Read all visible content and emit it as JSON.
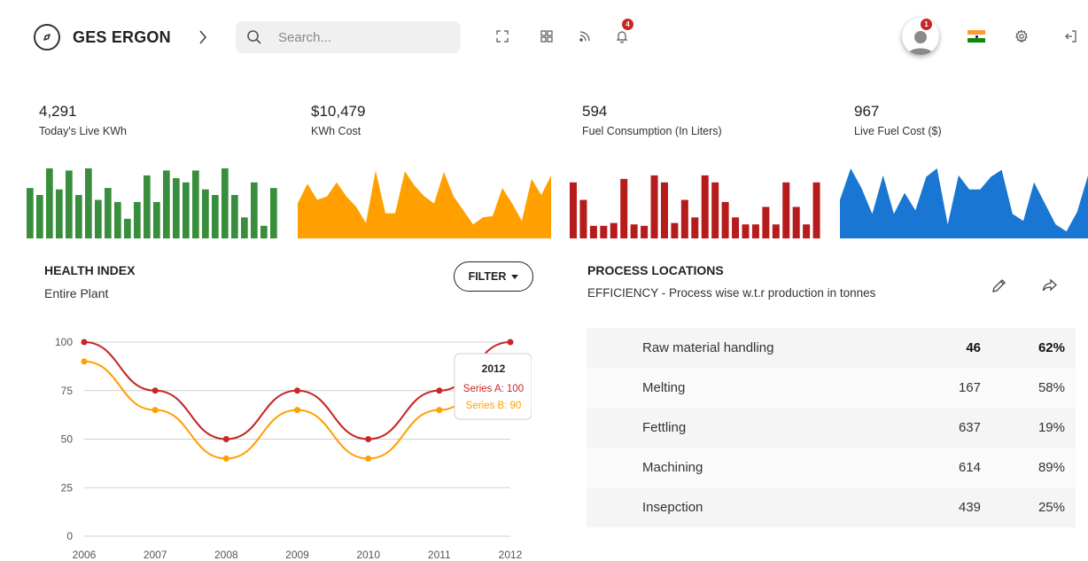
{
  "header": {
    "brand": "GES ERGON",
    "search_placeholder": "Search...",
    "notification_count": "4",
    "avatar_badge": "1",
    "icons": [
      "compass-icon",
      "chevron-right-icon",
      "search-icon",
      "fullscreen-icon",
      "apps-grid-icon",
      "rss-icon",
      "bell-icon",
      "avatar-icon",
      "india-flag-icon",
      "gear-icon",
      "logout-icon"
    ]
  },
  "kpis": [
    {
      "value": "4,291",
      "label": "Today's Live KWh",
      "color": "#388e3c"
    },
    {
      "value": "$10,479",
      "label": "KWh Cost",
      "color": "#ffa000"
    },
    {
      "value": "594",
      "label": "Fuel Consumption (In Liters)",
      "color": "#b71c1c"
    },
    {
      "value": "967",
      "label": "Live Fuel Cost ($)",
      "color": "#1976d2"
    }
  ],
  "sparklines": {
    "kwh_bars": [
      0.72,
      0.62,
      1.0,
      0.7,
      0.97,
      0.62,
      1.0,
      0.55,
      0.72,
      0.52,
      0.28,
      0.52,
      0.9,
      0.52,
      0.97,
      0.86,
      0.8,
      0.97,
      0.7,
      0.62,
      1.0,
      0.62,
      0.3,
      0.8,
      0.18,
      0.72
    ],
    "kwh_cost_area": [
      0.5,
      0.78,
      0.55,
      0.6,
      0.8,
      0.6,
      0.45,
      0.22,
      0.97,
      0.36,
      0.36,
      0.96,
      0.75,
      0.6,
      0.5,
      0.95,
      0.6,
      0.4,
      0.2,
      0.3,
      0.32,
      0.72,
      0.5,
      0.25,
      0.85,
      0.62,
      0.9
    ],
    "fuel_bars": [
      0.8,
      0.55,
      0.18,
      0.18,
      0.22,
      0.85,
      0.2,
      0.18,
      0.9,
      0.8,
      0.22,
      0.55,
      0.3,
      0.9,
      0.8,
      0.52,
      0.3,
      0.2,
      0.2,
      0.45,
      0.2,
      0.8,
      0.45,
      0.2,
      0.8
    ],
    "fuel_cost_area": [
      0.55,
      1.0,
      0.72,
      0.35,
      0.9,
      0.35,
      0.65,
      0.4,
      0.88,
      1.0,
      0.2,
      0.9,
      0.7,
      0.7,
      0.88,
      0.98,
      0.35,
      0.25,
      0.8,
      0.5,
      0.2,
      0.1,
      0.38,
      0.9
    ]
  },
  "health": {
    "title": "HEALTH INDEX",
    "subtitle": "Entire Plant",
    "filter_label": "FILTER",
    "tooltip": {
      "title": "2012",
      "series_a": "Series A: 100",
      "series_b": "Series B: 90"
    }
  },
  "chart_data": {
    "type": "line",
    "x": [
      "2006",
      "2007",
      "2008",
      "2009",
      "2010",
      "2011",
      "2012"
    ],
    "series": [
      {
        "name": "Series A",
        "values": [
          100,
          75,
          50,
          75,
          50,
          75,
          100
        ],
        "color": "#c62828"
      },
      {
        "name": "Series B",
        "values": [
          90,
          65,
          40,
          65,
          40,
          65,
          90
        ],
        "color": "#ffa000"
      }
    ],
    "ylim": [
      0,
      100
    ],
    "yticks": [
      "0",
      "25",
      "50",
      "75",
      "100"
    ],
    "grid": true
  },
  "process": {
    "title": "PROCESS LOCATIONS",
    "subtitle": "EFFICIENCY - Process wise w.t.r production in tonnes",
    "rows": [
      {
        "name": "Raw material handling",
        "value": "46",
        "pct": "62%"
      },
      {
        "name": "Melting",
        "value": "167",
        "pct": "58%"
      },
      {
        "name": "Fettling",
        "value": "637",
        "pct": "19%"
      },
      {
        "name": "Machining",
        "value": "614",
        "pct": "89%"
      },
      {
        "name": "Insepction",
        "value": "439",
        "pct": "25%"
      }
    ]
  }
}
